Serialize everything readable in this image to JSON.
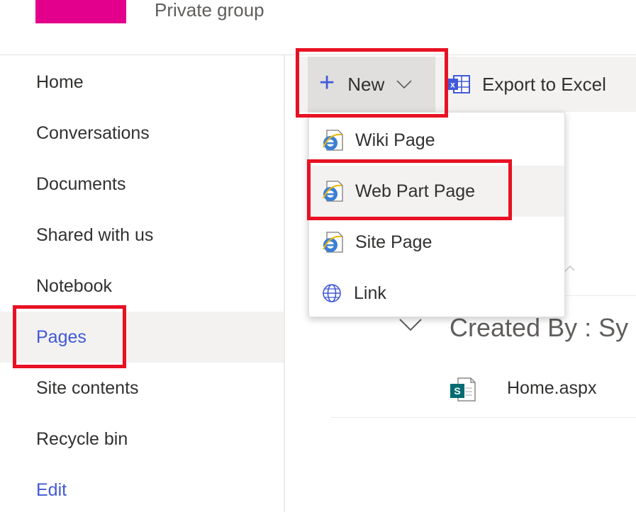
{
  "header": {
    "group_type": "Private group",
    "brand_color": "#e3008c"
  },
  "nav": {
    "items": [
      {
        "label": "Home"
      },
      {
        "label": "Conversations"
      },
      {
        "label": "Documents"
      },
      {
        "label": "Shared with us"
      },
      {
        "label": "Notebook"
      },
      {
        "label": "Pages"
      },
      {
        "label": "Site contents"
      },
      {
        "label": "Recycle bin"
      },
      {
        "label": "Edit"
      }
    ],
    "selected": "Pages",
    "accent_color": "#4159d8"
  },
  "command_bar": {
    "new_label": "New",
    "export_label": "Export to Excel"
  },
  "new_menu": {
    "items": [
      {
        "label": "Wiki Page",
        "icon": "ie-page-icon"
      },
      {
        "label": "Web Part Page",
        "icon": "ie-page-icon"
      },
      {
        "label": "Site Page",
        "icon": "ie-page-icon"
      },
      {
        "label": "Link",
        "icon": "globe-icon"
      }
    ]
  },
  "list": {
    "group_header": "Created By : Sy",
    "files": [
      {
        "name": "Home.aspx",
        "icon": "sharepoint-page-icon"
      }
    ]
  },
  "highlight_color": "#e81123"
}
